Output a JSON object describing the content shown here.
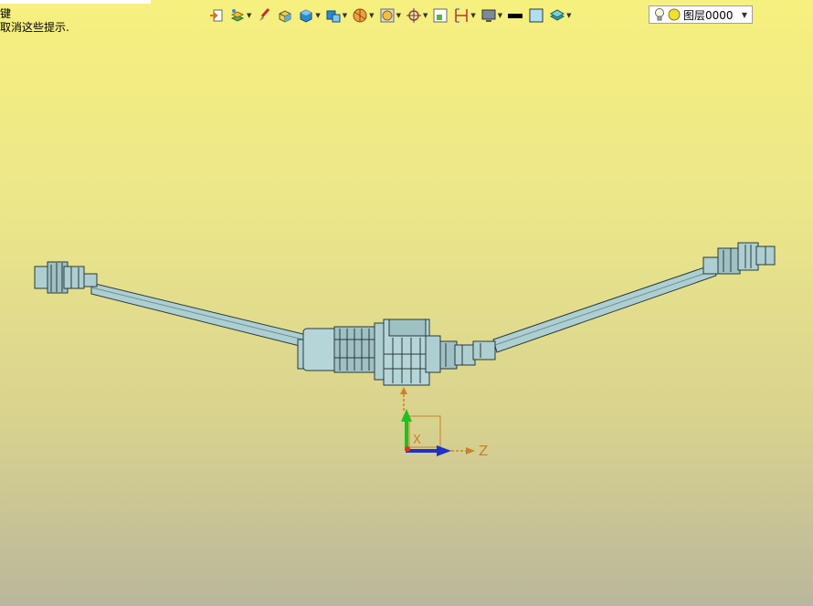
{
  "hint": {
    "line1": "键",
    "line2": "取消这些提示."
  },
  "toolbar": {
    "buttons": [
      {
        "icon": "exit-icon",
        "dropdown": false
      },
      {
        "icon": "layers-icon",
        "dropdown": true
      },
      {
        "icon": "brush-icon",
        "dropdown": false
      },
      {
        "icon": "box-wireframe-icon",
        "dropdown": false
      },
      {
        "icon": "cube-shaded-icon",
        "dropdown": true
      },
      {
        "icon": "view-orient-icon",
        "dropdown": true
      },
      {
        "icon": "section-icon",
        "dropdown": true
      },
      {
        "icon": "render-mode-icon",
        "dropdown": true
      },
      {
        "icon": "snap-target-icon",
        "dropdown": true
      },
      {
        "icon": "select-filter-icon",
        "dropdown": false
      },
      {
        "icon": "measure-icon",
        "dropdown": true
      },
      {
        "icon": "monitor-icon",
        "dropdown": true
      },
      {
        "icon": "line-color-icon",
        "dropdown": false
      },
      {
        "icon": "fill-color-icon",
        "dropdown": false
      },
      {
        "icon": "layer-stack-icon",
        "dropdown": true
      }
    ],
    "layer_selector": {
      "value": "图层0000"
    }
  },
  "viewport": {
    "axis_z_label": "Z",
    "axis_x_label": "X"
  },
  "colors": {
    "bg_top": "#f6f07e",
    "bg_bottom": "#b9b79c",
    "part_fill": "#aecfd2",
    "axis_y": "#22c022",
    "axis_z": "#2030c8",
    "axis_x": "#c9822a"
  }
}
